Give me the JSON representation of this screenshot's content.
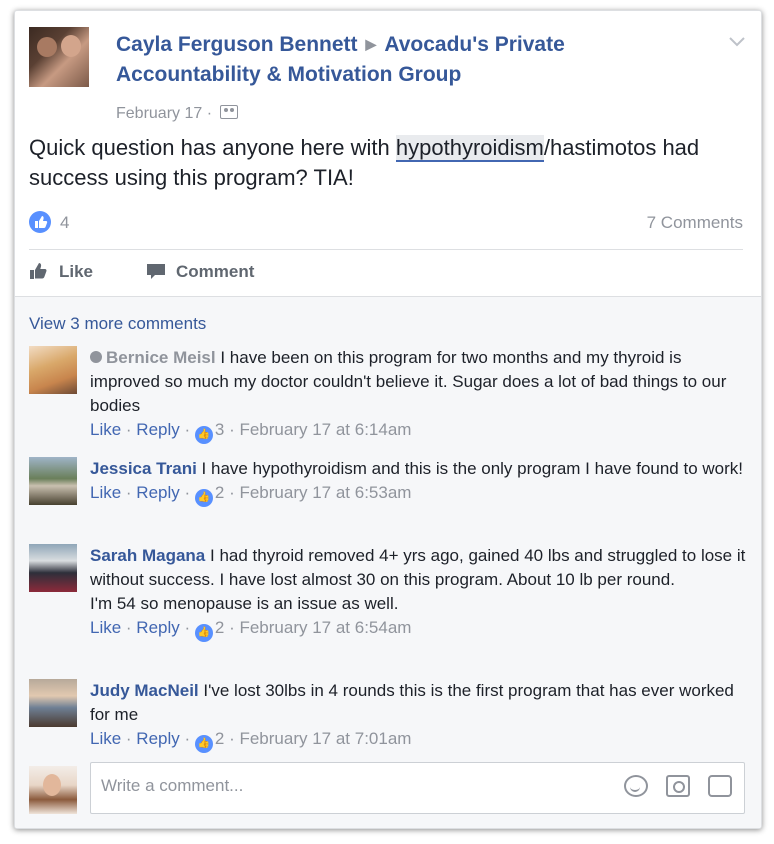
{
  "post": {
    "author": "Cayla Ferguson Bennett",
    "arrow": "▶",
    "group": "Avocadu's Private Accountability & Motivation Group",
    "date": "February 17",
    "dot": " · ",
    "text_before": "Quick question has anyone here with ",
    "text_highlight": "hypothyroidism",
    "text_after": "/hastimotos had success using this program? TIA!",
    "like_count": "4",
    "comments_count": "7 Comments",
    "actions": {
      "like": "Like",
      "comment": "Comment"
    }
  },
  "comments_section": {
    "view_more": "View 3 more comments",
    "comments": [
      {
        "name": "Bernice Meisl",
        "text": "I have been on this program for two months and my thyroid is improved so much my doctor couldn't believe it. Sugar does a lot of bad things to our bodies",
        "like": "Like",
        "reply": "Reply",
        "likes": "3",
        "time": "February 17 at 6:14am"
      },
      {
        "name": "Jessica Trani",
        "text": "I have hypothyroidism and this is the only program I have found to work!",
        "like": "Like",
        "reply": "Reply",
        "likes": "2",
        "time": "February 17 at 6:53am"
      },
      {
        "name": "Sarah Magana",
        "text": "I had thyroid removed 4+ yrs ago, gained 40 lbs and struggled to lose it without success. I have lost almost 30 on this program. About 10 lb per round.",
        "text2": "I'm 54 so menopause is an issue as well.",
        "like": "Like",
        "reply": "Reply",
        "likes": "2",
        "time": "February 17 at 6:54am"
      },
      {
        "name": "Judy MacNeil",
        "text": "I've lost 30lbs in 4 rounds this is the first program that has ever worked for me",
        "like": "Like",
        "reply": "Reply",
        "likes": "2",
        "time": "February 17 at 7:01am"
      }
    ],
    "composer_placeholder": "Write a comment..."
  },
  "separators": {
    "dot": " · "
  },
  "colors": {
    "link": "#365899",
    "meta": "#90949c",
    "like_blue": "#5890ff",
    "comments_bg": "#f6f7f9"
  },
  "icons": {
    "chevron": "chevron-down-icon",
    "group": "group-icon",
    "like_bubble": "thumbs-up-icon",
    "emoji": "emoji-icon",
    "camera": "camera-icon",
    "sticker": "sticker-icon"
  }
}
